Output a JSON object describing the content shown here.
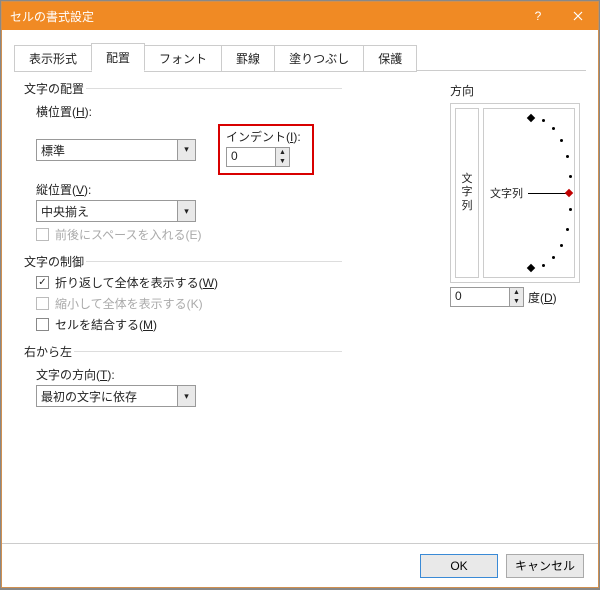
{
  "title": "セルの書式設定",
  "tabs": [
    "表示形式",
    "配置",
    "フォント",
    "罫線",
    "塗りつぶし",
    "保護"
  ],
  "sections": {
    "alignment": "文字の配置",
    "control": "文字の制御",
    "rtl": "右から左",
    "orientation": "方向"
  },
  "labels": {
    "horizontal": "横位置(",
    "horizontal_u": "H",
    "horizontal_end": "):",
    "vertical": "縦位置(",
    "vertical_u": "V",
    "vertical_end": "):",
    "indent": "インデント(",
    "indent_u": "I",
    "indent_end": "):",
    "direction": "文字の方向(",
    "direction_u": "T",
    "direction_end": "):",
    "degrees": "度(",
    "degrees_u": "D",
    "degrees_end": ")"
  },
  "values": {
    "horizontal": "標準",
    "vertical": "中央揃え",
    "indent": "0",
    "direction": "最初の文字に依存",
    "degrees": "0"
  },
  "checks": {
    "space": "前後にスペースを入れる(E)",
    "wrap_a": "折り返して全体を表示する(",
    "wrap_u": "W",
    "wrap_b": ")",
    "shrink": "縮小して全体を表示する(K)",
    "merge_a": "セルを結合する(",
    "merge_u": "M",
    "merge_b": ")"
  },
  "orient": {
    "vlabel": "文字列",
    "hlabel": "文字列"
  },
  "buttons": {
    "ok": "OK",
    "cancel": "キャンセル"
  }
}
